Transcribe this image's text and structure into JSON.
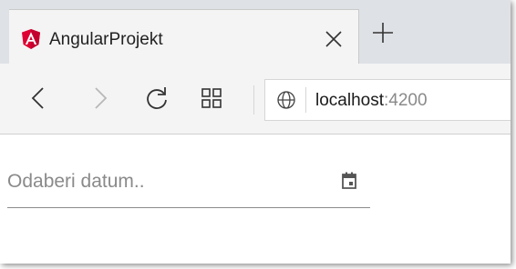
{
  "browser": {
    "tab": {
      "title": "AngularProjekt",
      "favicon": "angular-logo-icon",
      "close_icon": "close-icon"
    },
    "new_tab_icon": "plus-icon",
    "toolbar": {
      "back_icon": "back-icon",
      "forward_icon": "forward-icon",
      "reload_icon": "reload-icon",
      "tabs_overview_icon": "grid-icon"
    },
    "address": {
      "site_icon": "globe-icon",
      "host": "localhost",
      "port": ":4200"
    }
  },
  "page": {
    "datepicker": {
      "placeholder": "Odaberi datum..",
      "value": "",
      "toggle_icon": "calendar-icon"
    }
  },
  "colors": {
    "angular_red": "#dd0031",
    "tabstrip_bg": "#dee1e6",
    "toolbar_bg": "#f4f4f4"
  }
}
